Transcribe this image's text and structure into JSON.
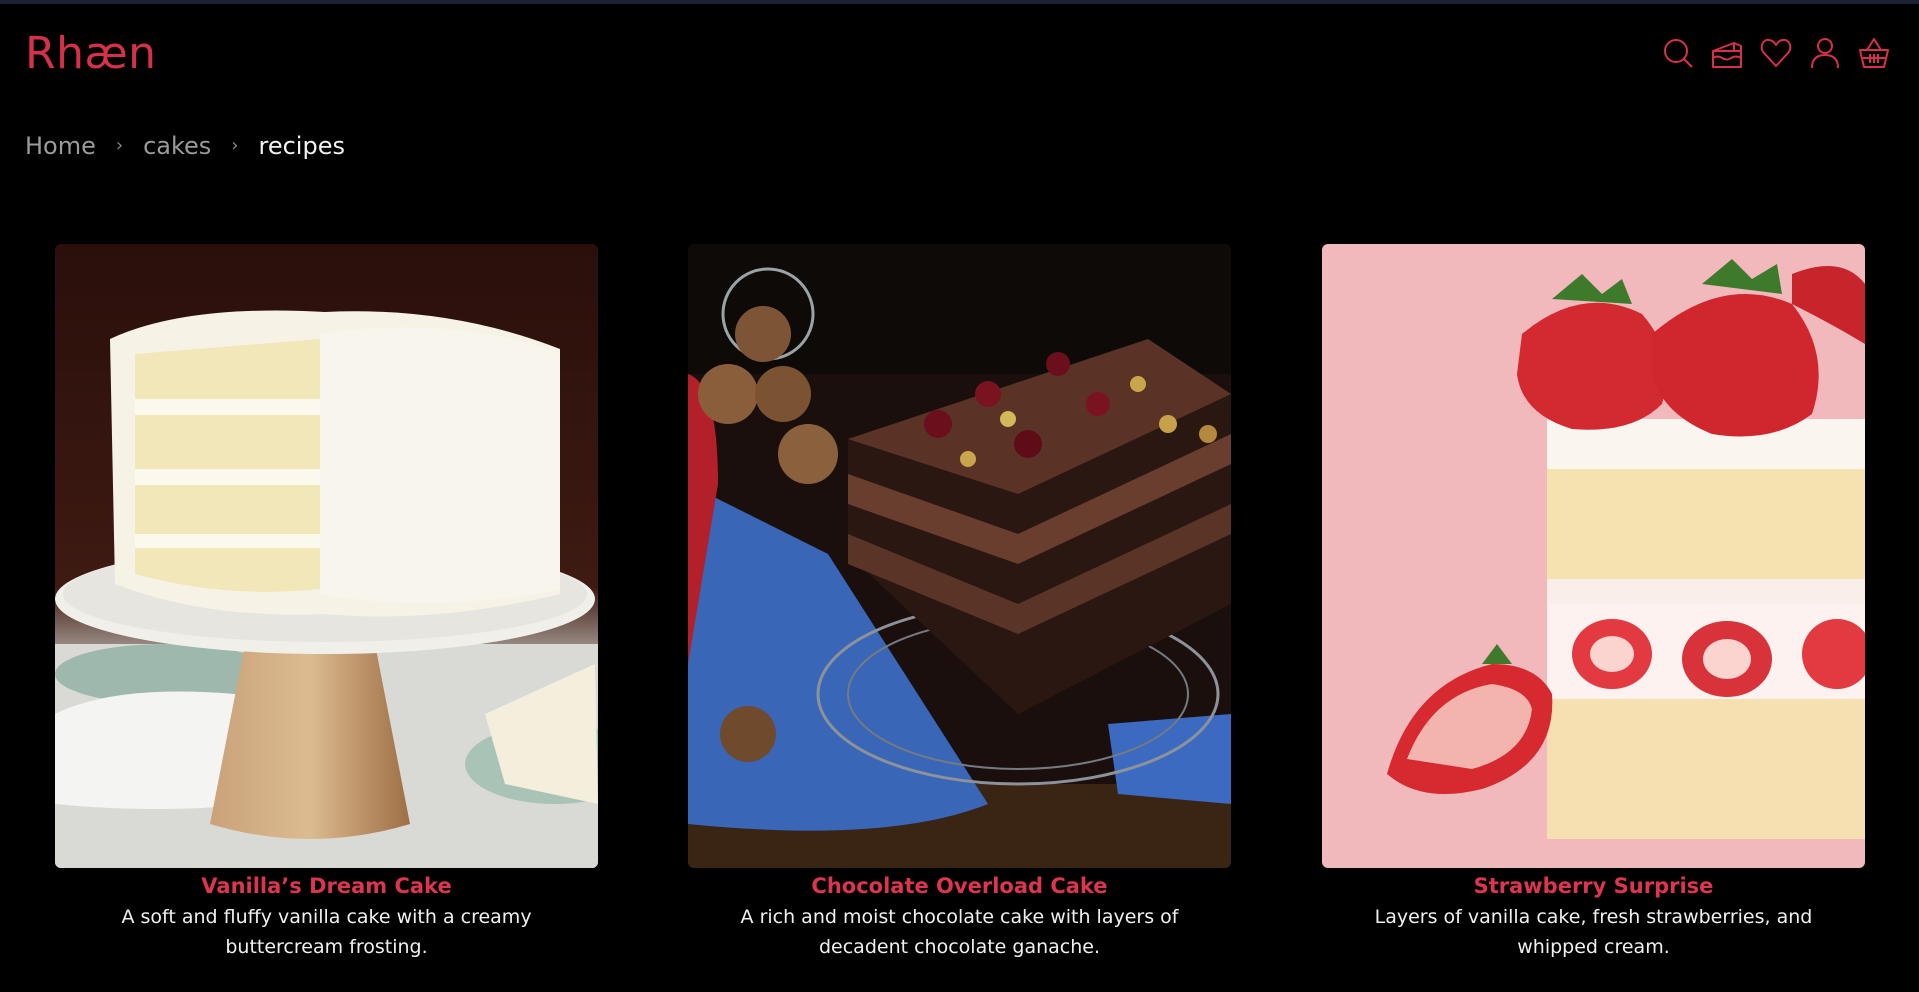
{
  "brand": {
    "name": "Rhæn",
    "accent": "#dc3550"
  },
  "header": {
    "icons": [
      "search-icon",
      "cake-icon",
      "heart-icon",
      "user-icon",
      "basket-icon"
    ]
  },
  "breadcrumb": {
    "items": [
      "Home",
      "cakes",
      "recipes"
    ],
    "separator": "›"
  },
  "recipes": [
    {
      "title": "Vanilla’s Dream Cake",
      "description": "A soft and fluffy vanilla cake with a creamy buttercream frosting."
    },
    {
      "title": "Chocolate Overload Cake",
      "description": "A rich and moist chocolate cake with layers of decadent chocolate ganache."
    },
    {
      "title": "Strawberry Surprise",
      "description": "Layers of vanilla cake, fresh strawberries, and whipped cream."
    }
  ]
}
